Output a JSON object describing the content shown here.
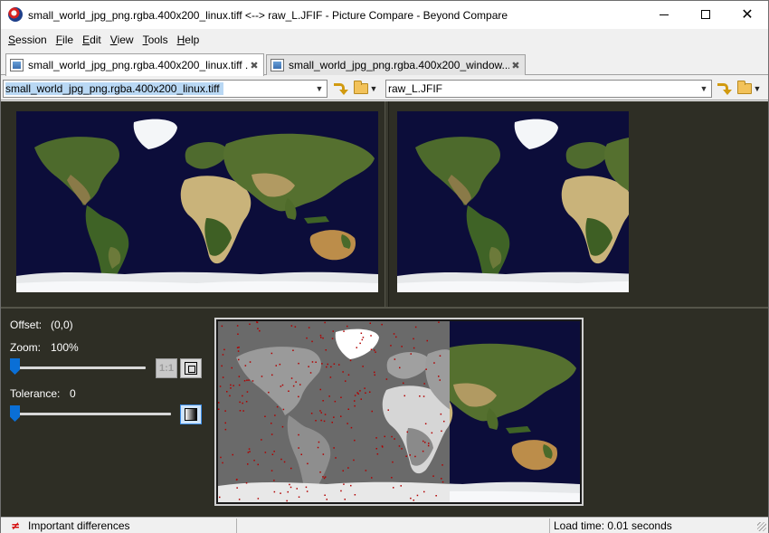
{
  "window": {
    "title": "small_world_jpg_png.rgba.400x200_linux.tiff <--> raw_L.JFIF - Picture Compare - Beyond Compare"
  },
  "menu": {
    "items": [
      {
        "label": "Session",
        "underline": "S",
        "rest": "ession"
      },
      {
        "label": "File",
        "underline": "F",
        "rest": "ile"
      },
      {
        "label": "Edit",
        "underline": "E",
        "rest": "dit"
      },
      {
        "label": "View",
        "underline": "V",
        "rest": "iew"
      },
      {
        "label": "Tools",
        "underline": "T",
        "rest": "ools"
      },
      {
        "label": "Help",
        "underline": "H",
        "rest": "elp"
      }
    ]
  },
  "tabs": [
    {
      "label": "small_world_jpg_png.rgba.400x200_linux.tiff ...",
      "close": "✖",
      "active": true
    },
    {
      "label": "small_world_jpg_png.rgba.400x200_window...",
      "close": "✖",
      "active": false
    }
  ],
  "paths": {
    "left": "small_world_jpg_png.rgba.400x200_linux.tiff",
    "right": "raw_L.JFIF"
  },
  "controls": {
    "offset_label": "Offset:",
    "offset_value": "(0,0)",
    "zoom_label": "Zoom:",
    "zoom_value": "100%",
    "zoom_fraction": 0.0,
    "one_to_one_label": "1:1",
    "tolerance_label": "Tolerance:",
    "tolerance_value": "0",
    "tolerance_fraction": 0.0
  },
  "status": {
    "icon": "≠",
    "text": "Important differences",
    "load_time": "Load time: 0.01 seconds"
  },
  "colors": {
    "pane_background": "#2e2e25",
    "ocean": "#0c0d3a",
    "difference_mark": "#b10000",
    "accent": "#0a6fd6"
  },
  "icons": {
    "swap": "swap-arrow-icon",
    "open": "folder-icon",
    "fit": "fit-to-window-icon",
    "tolerance_mode": "gradient-icon",
    "difference": "not-equal-icon"
  }
}
